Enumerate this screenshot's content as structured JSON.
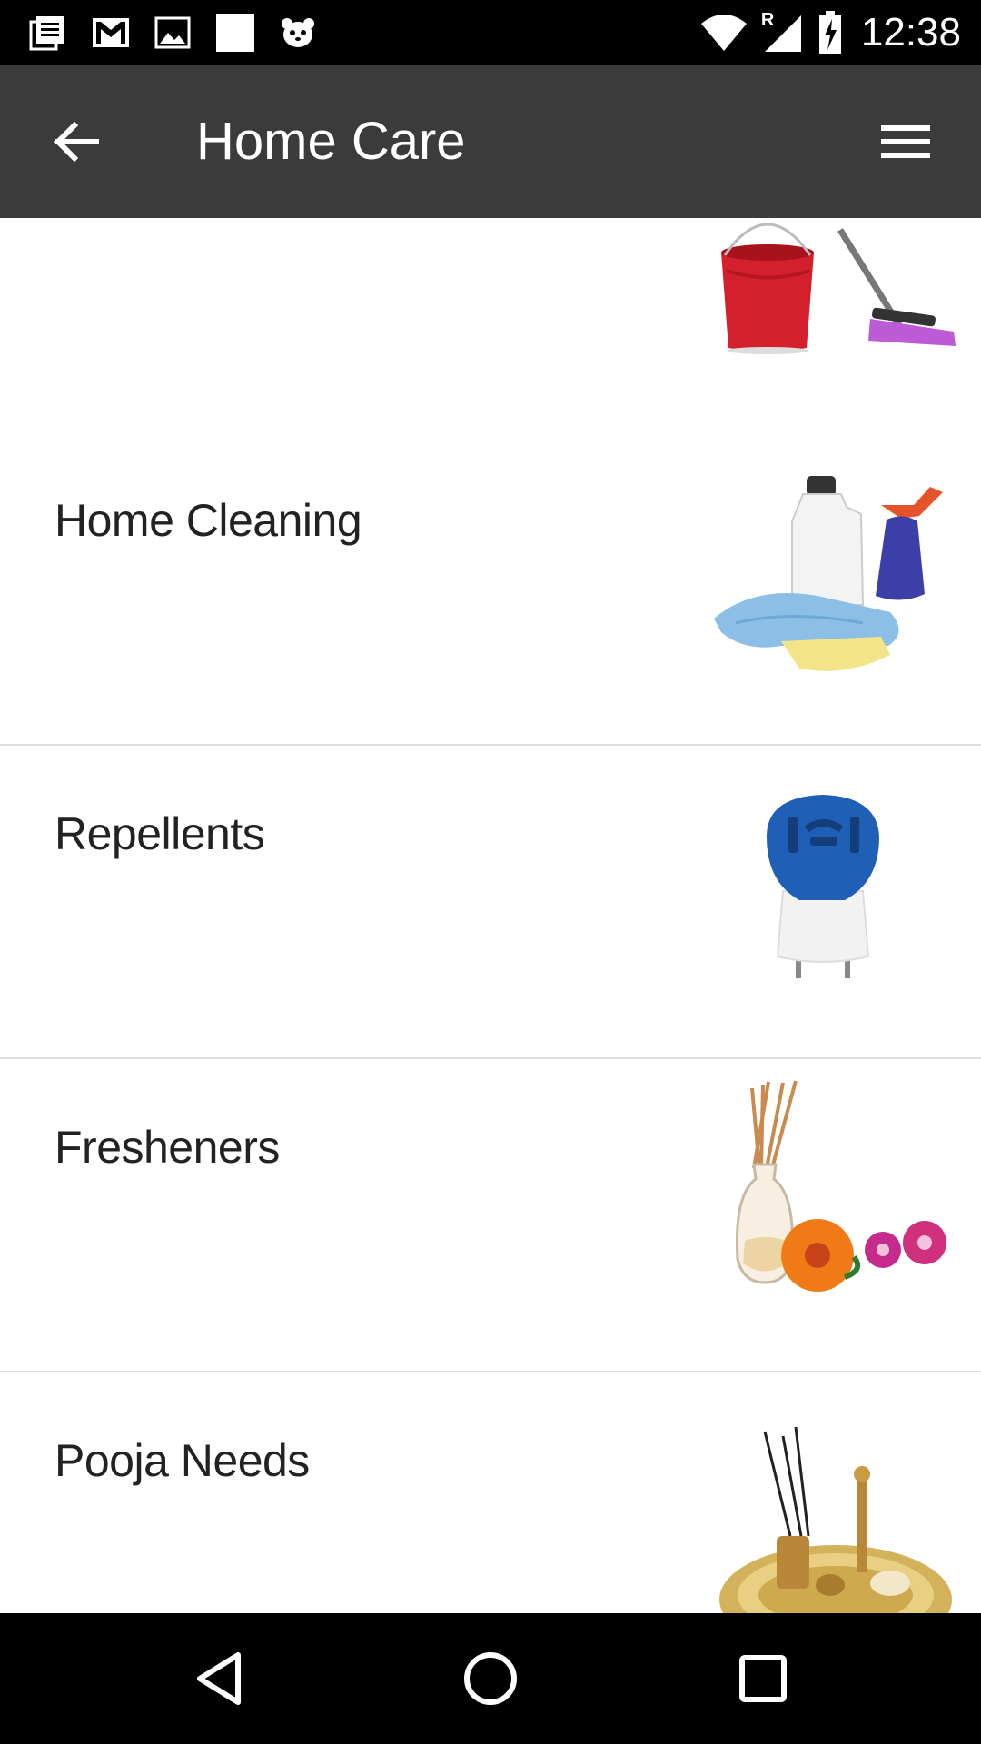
{
  "status_bar": {
    "time": "12:38",
    "left_icons": [
      "notes-icon",
      "gmail-icon",
      "gallery-icon",
      "blank-notification-icon",
      "foodpanda-icon"
    ],
    "right_icons": [
      "wifi-icon",
      "roaming-signal-icon",
      "battery-charging-icon"
    ],
    "roaming_letter": "R"
  },
  "app_bar": {
    "title": "Home Care",
    "back_icon": "arrow-left-icon",
    "menu_icon": "hamburger-menu-icon",
    "background": "#3b3b3b"
  },
  "categories": [
    {
      "label": "",
      "image": "bucket-and-mop"
    },
    {
      "label": "Home Cleaning",
      "image": "cleaning-supplies"
    },
    {
      "label": "Repellents",
      "image": "mosquito-repellent-plug"
    },
    {
      "label": "Fresheners",
      "image": "reed-diffuser-flowers"
    },
    {
      "label": "Pooja Needs",
      "image": "pooja-thali"
    }
  ],
  "nav_bar": {
    "icons": [
      "back-triangle-icon",
      "home-circle-icon",
      "recents-square-icon"
    ]
  }
}
